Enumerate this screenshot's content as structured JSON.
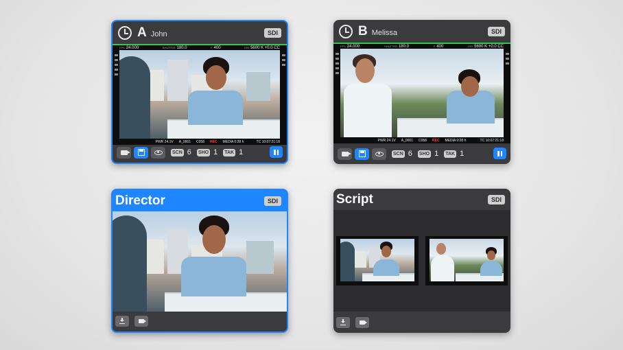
{
  "cameras": [
    {
      "letter": "A",
      "name": "John",
      "output": "SDI",
      "top_status": {
        "fps_label": "FPS",
        "fps": "24.000",
        "shutter_label": "SHUTTER",
        "shutter": "180.0",
        "iris_label": "F",
        "iris": "400",
        "iso_label": "ISO",
        "wb": "5600 K +0.0 CC"
      },
      "bottom_status": {
        "power_label": "PWR",
        "power": "24.1V",
        "clip": "A_0001",
        "clip_num": "C058",
        "rec": "REC",
        "media_label": "MEDIA",
        "media": "0:28 h",
        "tc_label": "TC",
        "timecode": "10:07:21:18"
      },
      "slate": {
        "scene_label": "SCN",
        "scene": "6",
        "shot_label": "SHO",
        "shot": "1",
        "take_label": "TAK",
        "take": "1"
      }
    },
    {
      "letter": "B",
      "name": "Melissa",
      "output": "SDI",
      "top_status": {
        "fps_label": "FPS",
        "fps": "24.000",
        "shutter_label": "SHUTTER",
        "shutter": "180.0",
        "iris_label": "F",
        "iris": "400",
        "iso_label": "ISO",
        "wb": "5600 K +0.0 CC"
      },
      "bottom_status": {
        "power_label": "PWR",
        "power": "24.1V",
        "clip": "A_0001",
        "clip_num": "C058",
        "rec": "REC",
        "media_label": "MEDIA",
        "media": "0:28 h",
        "tc_label": "TC",
        "timecode": "10:07:21:18"
      },
      "slate": {
        "scene_label": "SCN",
        "scene": "6",
        "shot_label": "SHO",
        "shot": "1",
        "take_label": "TAK",
        "take": "1"
      }
    }
  ],
  "director": {
    "title": "Director",
    "output": "SDI"
  },
  "script": {
    "title": "Script",
    "output": "SDI"
  },
  "colors": {
    "accent": "#1f86ff",
    "panel": "#3b3b3d",
    "rec": "#ff3b30",
    "tally": "#2fcb51"
  },
  "icons": [
    "sync-icon",
    "video-icon",
    "save-icon",
    "eye-icon",
    "pause-icon",
    "download-icon"
  ]
}
